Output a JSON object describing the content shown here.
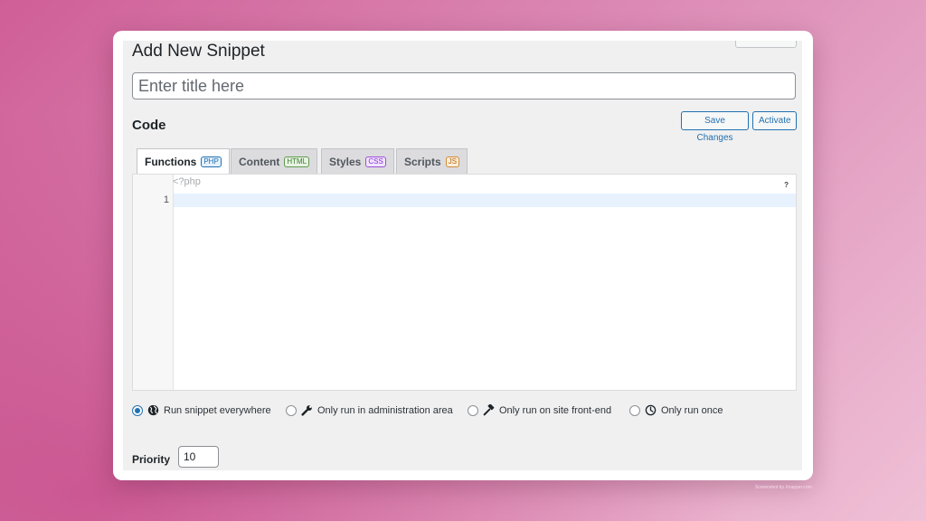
{
  "header": {
    "title": "Add New Snippet",
    "top_button_label": "· · ·"
  },
  "title_field": {
    "placeholder": "Enter title here",
    "value": ""
  },
  "code_section": {
    "heading": "Code",
    "save_label": "Save Changes",
    "activate_label": "Activate"
  },
  "tabs": [
    {
      "label": "Functions",
      "badge": "PHP",
      "active": true
    },
    {
      "label": "Content",
      "badge": "HTML",
      "active": false
    },
    {
      "label": "Styles",
      "badge": "CSS",
      "active": false
    },
    {
      "label": "Scripts",
      "badge": "JS",
      "active": false
    }
  ],
  "editor": {
    "prefix": "<?php",
    "line_number": "1",
    "help": "?"
  },
  "scope_options": [
    {
      "label": "Run snippet everywhere",
      "icon": "globe-icon",
      "checked": true
    },
    {
      "label": "Only run in administration area",
      "icon": "wrench-icon",
      "checked": false
    },
    {
      "label": "Only run on site front-end",
      "icon": "hammer-icon",
      "checked": false
    },
    {
      "label": "Only run once",
      "icon": "clock-icon",
      "checked": false
    }
  ],
  "priority": {
    "label": "Priority",
    "value": "10"
  },
  "footer": {
    "watermark": "Screenshot by Xnapper.com"
  },
  "colors": {
    "accent": "#2271b1",
    "panel": "#f0f0f1",
    "text": "#1d2327"
  }
}
